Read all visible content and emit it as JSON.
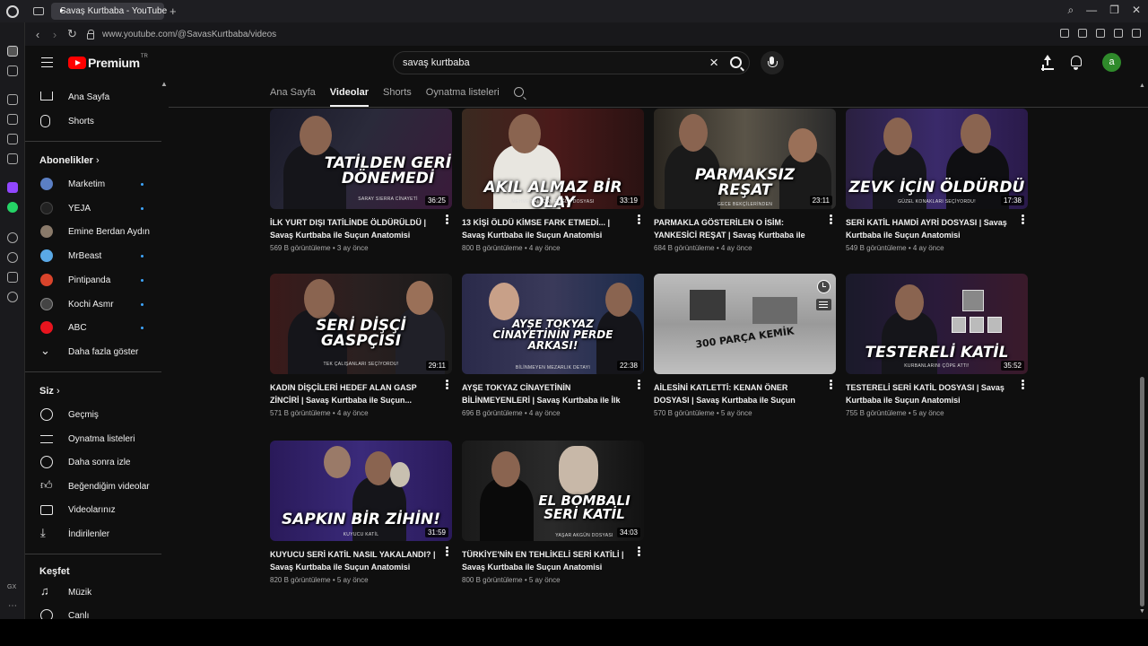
{
  "browser": {
    "tab_title": "Savaş Kurtbaba - YouTube",
    "url": "www.youtube.com/@SavasKurtbaba/videos"
  },
  "header": {
    "logo_text": "Premium",
    "logo_sup": "TR",
    "search_value": "savaş kurtbaba",
    "avatar_letter": "a",
    "avatar_color": "#2f8a2b"
  },
  "sidebar": {
    "main": [
      {
        "label": "Ana Sayfa",
        "icon": "home-icon"
      },
      {
        "label": "Shorts",
        "icon": "shorts-icon"
      }
    ],
    "subscriptions_title": "Abonelikler",
    "subscriptions": [
      {
        "label": "Marketim",
        "new": true,
        "color": "#5b7fc4"
      },
      {
        "label": "YEJA",
        "new": true,
        "color": "#222"
      },
      {
        "label": "Emine Berdan Aydın",
        "new": false,
        "color": "#8a7a6a"
      },
      {
        "label": "MrBeast",
        "new": true,
        "color": "#5aa9e6"
      },
      {
        "label": "Pintipanda",
        "new": true,
        "color": "#d9442b"
      },
      {
        "label": "Kochi Asmr",
        "new": true,
        "color": "#444"
      },
      {
        "label": "ABC",
        "new": true,
        "color": "#e8141e"
      }
    ],
    "show_more": "Daha fazla göster",
    "you_title": "Siz",
    "you": [
      {
        "label": "Geçmiş",
        "icon": "history-icon"
      },
      {
        "label": "Oynatma listeleri",
        "icon": "playlists-icon"
      },
      {
        "label": "Daha sonra izle",
        "icon": "watch-later-icon"
      },
      {
        "label": "Beğendiğim videolar",
        "icon": "like-icon"
      },
      {
        "label": "Videolarınız",
        "icon": "your-videos-icon"
      },
      {
        "label": "İndirilenler",
        "icon": "download-icon"
      }
    ],
    "explore_title": "Keşfet",
    "explore": [
      {
        "label": "Müzik",
        "icon": "music-icon"
      },
      {
        "label": "Canlı",
        "icon": "live-icon"
      }
    ]
  },
  "channel_tabs": [
    "Ana Sayfa",
    "Videolar",
    "Shorts",
    "Oynatma listeleri"
  ],
  "active_tab": "Videolar",
  "videos": [
    {
      "title": "İLK YURT DIŞI TATİLİNDE ÖLDÜRÜLDÜ | Savaş Kurtbaba ile Suçun Anatomisi",
      "views": "569 B görüntüleme",
      "age": "3 ay önce",
      "duration": "36:25",
      "thumb_text": "TATİLDEN GERİ DÖNEMEDİ",
      "thumb_sub": "SARAY SIERRA CİNAYETİ"
    },
    {
      "title": "13 KİŞİ ÖLDÜ KİMSE FARK ETMEDİ... | Savaş Kurtbaba ile Suçun Anatomisi",
      "views": "800 B görüntüleme",
      "age": "4 ay önce",
      "duration": "33:19",
      "thumb_text": "AKIL ALMAZ BİR OLAY",
      "thumb_sub": "MEHMET ALİ ÇAYIROĞLU DOSYASI"
    },
    {
      "title": "PARMAKLA GÖSTERİLEN O İSİM: YANKESİCİ REŞAT | Savaş Kurtbaba ile Suçun Anatomisi",
      "views": "684 B görüntüleme",
      "age": "4 ay önce",
      "duration": "23:11",
      "thumb_text": "PARMAKSIZ REŞAT",
      "thumb_sub": "GECE BEKÇİLERİNDEN"
    },
    {
      "title": "SERİ KATİL HAMDİ AYRİ DOSYASI | Savaş Kurtbaba ile Suçun Anatomisi",
      "views": "549 B görüntüleme",
      "age": "4 ay önce",
      "duration": "17:38",
      "thumb_text": "ZEVK İÇİN ÖLDÜRDÜ",
      "thumb_sub": "GÜZEL KONAKLARI SEÇİYORDU!"
    },
    {
      "title": "KADIN DİŞÇİLERİ HEDEF ALAN GASP ZİNCİRİ | Savaş Kurtbaba ile Suçun...",
      "views": "571 B görüntüleme",
      "age": "4 ay önce",
      "duration": "29:11",
      "thumb_text": "SERİ DİŞÇİ GASPÇISI",
      "thumb_sub": "TEK ÇALIŞANLARI SEÇİYORDU!"
    },
    {
      "title": "AYŞE TOKYAZ CİNAYETİNİN BİLİNMEYENLERİ | Savaş Kurtbaba ile İlk 4...",
      "views": "696 B görüntüleme",
      "age": "4 ay önce",
      "duration": "22:38",
      "thumb_text": "AYŞE TOKYAZ CİNAYETİNİN PERDE ARKASI!",
      "thumb_sub": "BİLİNMEYEN MEZARLIK DETAYI"
    },
    {
      "title": "AİLESİNİ KATLETTİ: KENAN ÖNER DOSYASI | Savaş Kurtbaba ile Suçun Anatomisi",
      "views": "570 B görüntüleme",
      "age": "5 ay önce",
      "duration": "",
      "thumb_text": "300 PARÇA KEMİK",
      "thumb_sub": ""
    },
    {
      "title": "TESTERELİ SERİ KATİL DOSYASI | Savaş Kurtbaba ile Suçun Anatomisi",
      "views": "755 B görüntüleme",
      "age": "5 ay önce",
      "duration": "35:52",
      "thumb_text": "TESTERELİ KATİL",
      "thumb_sub": "KURBANLARINI ÇÖPE ATTI!"
    },
    {
      "title": "KUYUCU SERİ KATİL NASIL YAKALANDI? | Savaş Kurtbaba ile Suçun Anatomisi",
      "views": "820 B görüntüleme",
      "age": "5 ay önce",
      "duration": "31:59",
      "thumb_text": "SAPKIN BİR ZİHİN!",
      "thumb_sub": "KUYUCU KATİL"
    },
    {
      "title": "TÜRKİYE'NİN EN TEHLİKELİ SERİ KATİLİ | Savaş Kurtbaba ile Suçun Anatomisi",
      "views": "800 B görüntüleme",
      "age": "5 ay önce",
      "duration": "34:03",
      "thumb_text": "EL BOMBALI SERİ KATİL",
      "thumb_sub": "YAŞAR AKGÜN DOSYASI"
    }
  ]
}
